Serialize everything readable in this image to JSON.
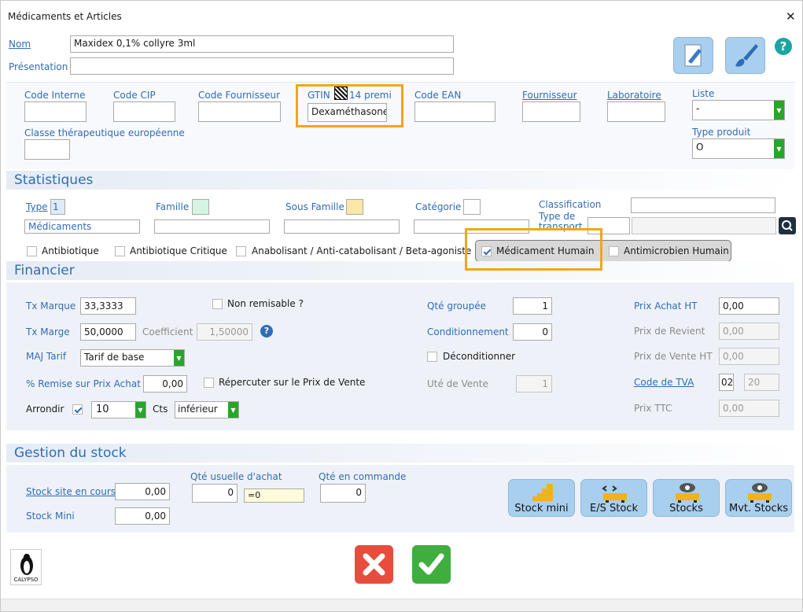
{
  "window": {
    "title": "Médicaments et Articles",
    "close": "✕"
  },
  "header": {
    "nom_label": "Nom",
    "nom_value": "Maxidex 0,1% collyre 3ml",
    "presentation_label": "Présentation",
    "presentation_value": "",
    "help": "?"
  },
  "codes": {
    "code_interne": "Code Interne",
    "code_cip": "Code CIP",
    "code_fournisseur": "Code Fournisseur",
    "gtin_label": "GTIN",
    "gtin_suffix": "14 premi",
    "gtin_value": "Dexaméthasone",
    "code_ean": "Code EAN",
    "fournisseur": "Fournisseur",
    "laboratoire": "Laboratoire",
    "liste_label": "Liste",
    "liste_value": "-",
    "classe": "Classe thérapeutique européenne",
    "type_produit_label": "Type produit",
    "type_produit_value": "O"
  },
  "statistiques": {
    "title": "Statistiques",
    "type_label": "Type",
    "type_value": "1",
    "type_text": "Médicaments",
    "famille": "Famille",
    "sous_famille": "Sous Famille",
    "categorie": "Catégorie",
    "classification": "Classification",
    "type_transport": "Type de transport",
    "checks": [
      "Antibiotique",
      "Antibiotique Critique",
      "Anabolisant / Anti-catabolisant / Beta-agoniste",
      "Médicament Humain",
      "Antimicrobien Humain"
    ],
    "colors": {
      "famille": "#d4f5e2",
      "sous_famille": "#fbe8a8",
      "type": "#e0ebf8"
    }
  },
  "financier": {
    "title": "Financier",
    "tx_marque_label": "Tx Marque",
    "tx_marque": "33,3333",
    "tx_marge_label": "Tx Marge",
    "tx_marge": "50,0000",
    "coefficient_label": "Coefficient",
    "coefficient": "1,50000",
    "maj_tarif_label": "MAJ Tarif",
    "maj_tarif": "Tarif de base",
    "remise_label": "% Remise sur Prix Achat",
    "remise": "0,00",
    "arrondir_label": "Arrondir",
    "arrondir_value": "10",
    "cts_label": "Cts",
    "cts_value": "inférieur",
    "non_remisable": "Non remisable ?",
    "repercuter": "Répercuter sur le Prix de Vente",
    "qte_groupee_label": "Qté groupée",
    "qte_groupee": "1",
    "conditionnement_label": "Conditionnement",
    "conditionnement": "0",
    "deconditionner": "Déconditionner",
    "ute_vente_label": "Uté de Vente",
    "ute_vente": "1",
    "prix_achat_label": "Prix Achat HT",
    "prix_achat": "0,00",
    "prix_revient_label": "Prix de Revient",
    "prix_revient": "0,00",
    "prix_vente_label": "Prix de Vente HT",
    "prix_vente": "0,00",
    "code_tva_label": "Code de TVA",
    "code_tva": "02",
    "taux_tva": "20",
    "prix_ttc_label": "Prix TTC",
    "prix_ttc": "0,00"
  },
  "stock": {
    "title": "Gestion du stock",
    "stock_site_label": "Stock site en cours",
    "stock_site": "0,00",
    "stock_mini_label": "Stock Mini",
    "stock_mini": "0,00",
    "qte_usuelle_label": "Qté usuelle d'achat",
    "qte_usuelle": "0",
    "qte_usuelle_eq": "=0",
    "qte_commande_label": "Qté en commande",
    "qte_commande": "0",
    "buttons": [
      "Stock mini",
      "E/S Stock",
      "Stocks",
      "Mvt. Stocks"
    ]
  },
  "footer": {
    "logo_text": "CALYPSO"
  }
}
